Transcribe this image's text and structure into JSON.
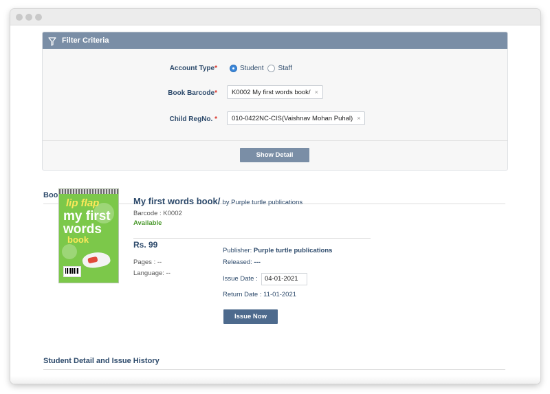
{
  "filter": {
    "header": "Filter Criteria",
    "account_type_label": "Account Type",
    "required_mark": "*",
    "radio_student": "Student",
    "radio_staff": "Staff",
    "selected_account_type": "Student",
    "book_barcode_label": "Book Barcode",
    "book_barcode_value": "K0002 My first words book/",
    "child_regno_label": "Child RegNo.",
    "child_regno_value": "010-0422NC-CIS(Vaishnav Mohan Puhal)",
    "clear_glyph": "×",
    "show_detail_button": "Show Detail"
  },
  "book_details": {
    "section_title": "Book Details",
    "title": "My first words book/",
    "by_line": "by Purple turtle publications",
    "barcode": "Barcode : K0002",
    "availability": "Available",
    "price": "Rs. 99",
    "pages": "Pages : --",
    "language": "Language: --",
    "publisher_label": "Publisher:",
    "publisher_value": "Purple turtle publications",
    "released_label": "Released:",
    "released_value": "---",
    "issue_date_label": "Issue Date :",
    "issue_date_value": "04-01-2021",
    "return_date": "Return Date : 11-01-2021",
    "issue_button": "Issue Now",
    "cover": {
      "line1": "lip flap",
      "line2a": "my first",
      "line2b": "words",
      "line3": "book"
    }
  },
  "student_section": {
    "title": "Student Detail and Issue History"
  },
  "colors": {
    "header_bg": "#7a8ea6",
    "label_text": "#2d4a6b",
    "available": "#4b9a2e",
    "radio_on": "#3a86d8",
    "required": "#d9342b"
  },
  "icons": {
    "filter": "funnel-icon",
    "window_controls": "window-dot-icon"
  }
}
